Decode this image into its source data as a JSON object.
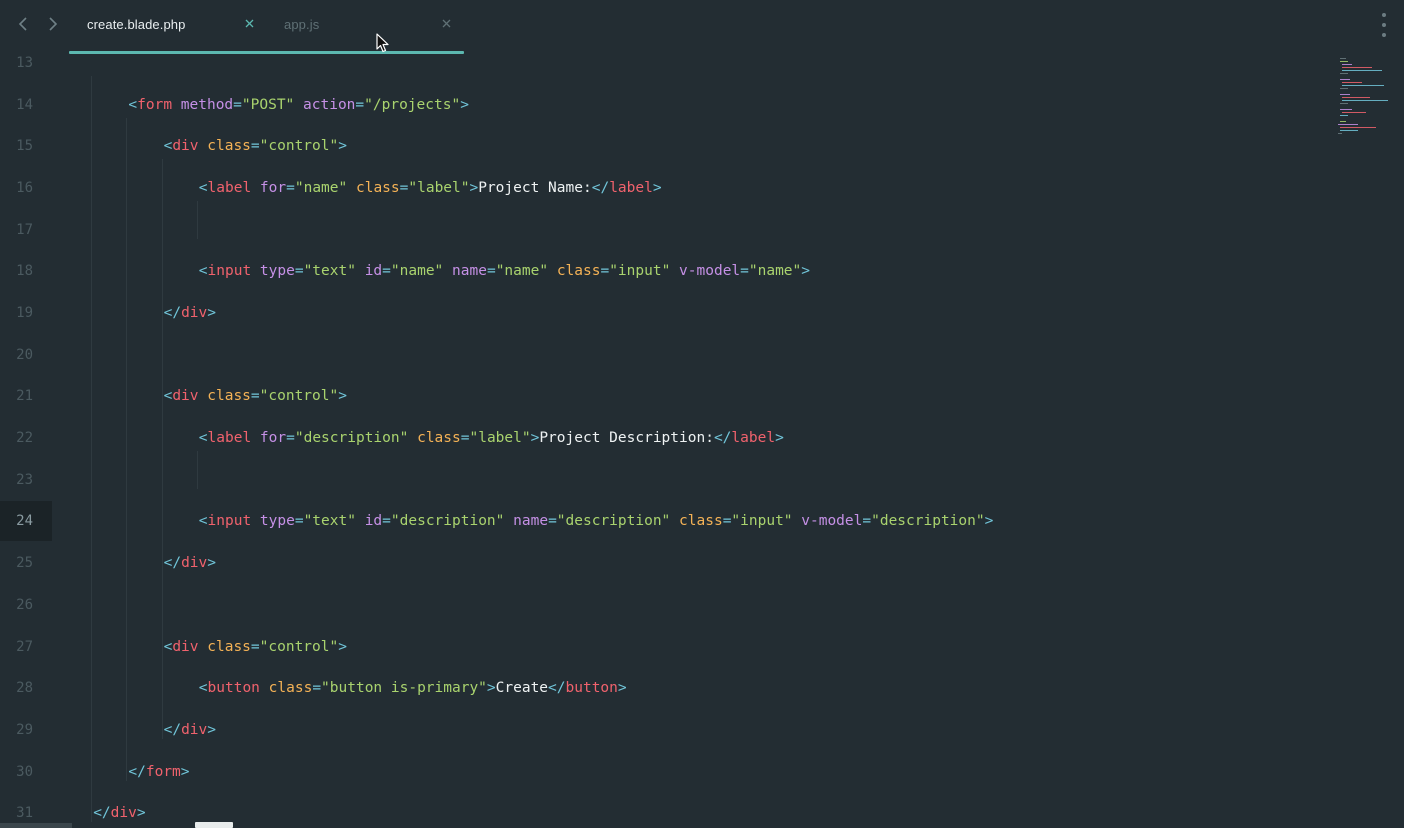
{
  "tabs": [
    {
      "label": "create.blade.php",
      "active": true
    },
    {
      "label": "app.js",
      "active": false
    }
  ],
  "icons": {
    "back": "chevron-left-icon",
    "forward": "chevron-right-icon",
    "close": "close-icon",
    "more": "more-vertical-icon"
  },
  "colors": {
    "background": "#232d33",
    "accent": "#5cb8b0",
    "punctuation": "#71c5d9",
    "tag": "#f0626d",
    "attribute_purple": "#c590e6",
    "attribute_orange": "#f4b256",
    "string": "#a9d36e",
    "text": "#eef2f3"
  },
  "editor": {
    "active_line": 24,
    "lines": [
      {
        "n": 13,
        "indent": 0,
        "tokens": []
      },
      {
        "n": 14,
        "indent": 2,
        "tokens": [
          {
            "t": "<",
            "c": "p"
          },
          {
            "t": "form",
            "c": "tag"
          },
          {
            "t": " ",
            "c": "txt"
          },
          {
            "t": "method",
            "c": "attr"
          },
          {
            "t": "=",
            "c": "p"
          },
          {
            "t": "\"POST\"",
            "c": "str"
          },
          {
            "t": " ",
            "c": "txt"
          },
          {
            "t": "action",
            "c": "attr"
          },
          {
            "t": "=",
            "c": "p"
          },
          {
            "t": "\"/projects\"",
            "c": "str"
          },
          {
            "t": ">",
            "c": "p"
          }
        ]
      },
      {
        "n": 15,
        "indent": 3,
        "tokens": [
          {
            "t": "<",
            "c": "p"
          },
          {
            "t": "div",
            "c": "tag"
          },
          {
            "t": " ",
            "c": "txt"
          },
          {
            "t": "class",
            "c": "attr2"
          },
          {
            "t": "=",
            "c": "p"
          },
          {
            "t": "\"control\"",
            "c": "str"
          },
          {
            "t": ">",
            "c": "p"
          }
        ]
      },
      {
        "n": 16,
        "indent": 4,
        "tokens": [
          {
            "t": "<",
            "c": "p"
          },
          {
            "t": "label",
            "c": "tag"
          },
          {
            "t": " ",
            "c": "txt"
          },
          {
            "t": "for",
            "c": "attr"
          },
          {
            "t": "=",
            "c": "p"
          },
          {
            "t": "\"name\"",
            "c": "str"
          },
          {
            "t": " ",
            "c": "txt"
          },
          {
            "t": "class",
            "c": "attr2"
          },
          {
            "t": "=",
            "c": "p"
          },
          {
            "t": "\"label\"",
            "c": "str"
          },
          {
            "t": ">",
            "c": "p"
          },
          {
            "t": "Project Name:",
            "c": "txt"
          },
          {
            "t": "</",
            "c": "p"
          },
          {
            "t": "label",
            "c": "tag"
          },
          {
            "t": ">",
            "c": "p"
          }
        ]
      },
      {
        "n": 17,
        "indent": 0,
        "tokens": []
      },
      {
        "n": 18,
        "indent": 4,
        "tokens": [
          {
            "t": "<",
            "c": "p"
          },
          {
            "t": "input",
            "c": "tag"
          },
          {
            "t": " ",
            "c": "txt"
          },
          {
            "t": "type",
            "c": "attr"
          },
          {
            "t": "=",
            "c": "p"
          },
          {
            "t": "\"text\"",
            "c": "str"
          },
          {
            "t": " ",
            "c": "txt"
          },
          {
            "t": "id",
            "c": "attr"
          },
          {
            "t": "=",
            "c": "p"
          },
          {
            "t": "\"name\"",
            "c": "str"
          },
          {
            "t": " ",
            "c": "txt"
          },
          {
            "t": "name",
            "c": "attr"
          },
          {
            "t": "=",
            "c": "p"
          },
          {
            "t": "\"name\"",
            "c": "str"
          },
          {
            "t": " ",
            "c": "txt"
          },
          {
            "t": "class",
            "c": "attr2"
          },
          {
            "t": "=",
            "c": "p"
          },
          {
            "t": "\"input\"",
            "c": "str"
          },
          {
            "t": " ",
            "c": "txt"
          },
          {
            "t": "v-model",
            "c": "attr"
          },
          {
            "t": "=",
            "c": "p"
          },
          {
            "t": "\"name\"",
            "c": "str"
          },
          {
            "t": ">",
            "c": "p"
          }
        ]
      },
      {
        "n": 19,
        "indent": 3,
        "tokens": [
          {
            "t": "</",
            "c": "p"
          },
          {
            "t": "div",
            "c": "tag"
          },
          {
            "t": ">",
            "c": "p"
          }
        ]
      },
      {
        "n": 20,
        "indent": 0,
        "tokens": []
      },
      {
        "n": 21,
        "indent": 3,
        "tokens": [
          {
            "t": "<",
            "c": "p"
          },
          {
            "t": "div",
            "c": "tag"
          },
          {
            "t": " ",
            "c": "txt"
          },
          {
            "t": "class",
            "c": "attr2"
          },
          {
            "t": "=",
            "c": "p"
          },
          {
            "t": "\"control\"",
            "c": "str"
          },
          {
            "t": ">",
            "c": "p"
          }
        ]
      },
      {
        "n": 22,
        "indent": 4,
        "tokens": [
          {
            "t": "<",
            "c": "p"
          },
          {
            "t": "label",
            "c": "tag"
          },
          {
            "t": " ",
            "c": "txt"
          },
          {
            "t": "for",
            "c": "attr"
          },
          {
            "t": "=",
            "c": "p"
          },
          {
            "t": "\"description\"",
            "c": "str"
          },
          {
            "t": " ",
            "c": "txt"
          },
          {
            "t": "class",
            "c": "attr2"
          },
          {
            "t": "=",
            "c": "p"
          },
          {
            "t": "\"label\"",
            "c": "str"
          },
          {
            "t": ">",
            "c": "p"
          },
          {
            "t": "Project Description:",
            "c": "txt"
          },
          {
            "t": "</",
            "c": "p"
          },
          {
            "t": "label",
            "c": "tag"
          },
          {
            "t": ">",
            "c": "p"
          }
        ]
      },
      {
        "n": 23,
        "indent": 0,
        "tokens": []
      },
      {
        "n": 24,
        "indent": 4,
        "tokens": [
          {
            "t": "<",
            "c": "p"
          },
          {
            "t": "input",
            "c": "tag"
          },
          {
            "t": " ",
            "c": "txt"
          },
          {
            "t": "type",
            "c": "attr"
          },
          {
            "t": "=",
            "c": "p"
          },
          {
            "t": "\"text\"",
            "c": "str"
          },
          {
            "t": " ",
            "c": "txt"
          },
          {
            "t": "id",
            "c": "attr"
          },
          {
            "t": "=",
            "c": "p"
          },
          {
            "t": "\"description\"",
            "c": "str"
          },
          {
            "t": " ",
            "c": "txt"
          },
          {
            "t": "name",
            "c": "attr"
          },
          {
            "t": "=",
            "c": "p"
          },
          {
            "t": "\"description\"",
            "c": "str"
          },
          {
            "t": " ",
            "c": "txt"
          },
          {
            "t": "class",
            "c": "attr2"
          },
          {
            "t": "=",
            "c": "p"
          },
          {
            "t": "\"input\"",
            "c": "str"
          },
          {
            "t": " ",
            "c": "txt"
          },
          {
            "t": "v-model",
            "c": "attr"
          },
          {
            "t": "=",
            "c": "p"
          },
          {
            "t": "\"description\"",
            "c": "str"
          },
          {
            "t": ">",
            "c": "p"
          }
        ]
      },
      {
        "n": 25,
        "indent": 3,
        "tokens": [
          {
            "t": "</",
            "c": "p"
          },
          {
            "t": "div",
            "c": "tag"
          },
          {
            "t": ">",
            "c": "p"
          }
        ]
      },
      {
        "n": 26,
        "indent": 0,
        "tokens": []
      },
      {
        "n": 27,
        "indent": 3,
        "tokens": [
          {
            "t": "<",
            "c": "p"
          },
          {
            "t": "div",
            "c": "tag"
          },
          {
            "t": " ",
            "c": "txt"
          },
          {
            "t": "class",
            "c": "attr2"
          },
          {
            "t": "=",
            "c": "p"
          },
          {
            "t": "\"control\"",
            "c": "str"
          },
          {
            "t": ">",
            "c": "p"
          }
        ]
      },
      {
        "n": 28,
        "indent": 4,
        "tokens": [
          {
            "t": "<",
            "c": "p"
          },
          {
            "t": "button",
            "c": "tag"
          },
          {
            "t": " ",
            "c": "txt"
          },
          {
            "t": "class",
            "c": "attr2"
          },
          {
            "t": "=",
            "c": "p"
          },
          {
            "t": "\"button is-primary\"",
            "c": "str"
          },
          {
            "t": ">",
            "c": "p"
          },
          {
            "t": "Create",
            "c": "txt"
          },
          {
            "t": "</",
            "c": "p"
          },
          {
            "t": "button",
            "c": "tag"
          },
          {
            "t": ">",
            "c": "p"
          }
        ]
      },
      {
        "n": 29,
        "indent": 3,
        "tokens": [
          {
            "t": "</",
            "c": "p"
          },
          {
            "t": "div",
            "c": "tag"
          },
          {
            "t": ">",
            "c": "p"
          }
        ]
      },
      {
        "n": 30,
        "indent": 2,
        "tokens": [
          {
            "t": "</",
            "c": "p"
          },
          {
            "t": "form",
            "c": "tag"
          },
          {
            "t": ">",
            "c": "p"
          }
        ]
      },
      {
        "n": 31,
        "indent": 1,
        "tokens": [
          {
            "t": "</",
            "c": "p"
          },
          {
            "t": "div",
            "c": "tag"
          },
          {
            "t": ">",
            "c": "p"
          }
        ]
      }
    ]
  }
}
